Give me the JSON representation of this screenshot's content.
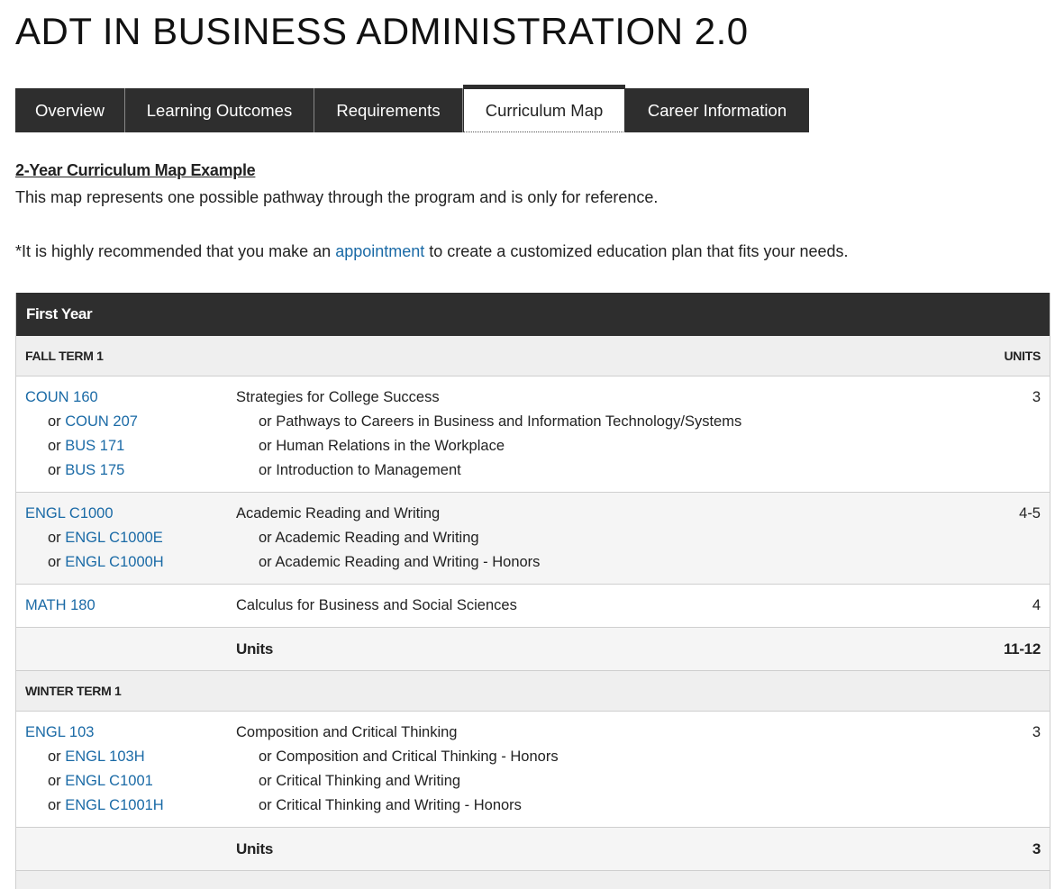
{
  "page": {
    "title": "ADT IN BUSINESS ADMINISTRATION 2.0"
  },
  "tabs": [
    {
      "label": "Overview",
      "active": false
    },
    {
      "label": "Learning Outcomes",
      "active": false
    },
    {
      "label": "Requirements",
      "active": false
    },
    {
      "label": "Curriculum Map",
      "active": true
    },
    {
      "label": "Career Information",
      "active": false
    }
  ],
  "intro": {
    "heading": "2-Year Curriculum Map Example",
    "text": "This map represents one possible pathway through the program and is only for reference.",
    "note_before": "*It is highly recommended that you make an ",
    "note_link": "appointment",
    "note_after": " to create a customized education plan that fits your needs."
  },
  "table": {
    "year_label": "First Year",
    "units_header": "UNITS",
    "units_label": "Units",
    "fall_term": {
      "label": "FALL TERM 1",
      "courses": [
        {
          "code": "COUN 160",
          "title": "Strategies for College Success",
          "units": "3",
          "alternatives": [
            {
              "code": "COUN 207",
              "title": "or Pathways to Careers in Business and Information Technology/Systems"
            },
            {
              "code": "BUS 171",
              "title": "or Human Relations in the Workplace"
            },
            {
              "code": "BUS 175",
              "title": "or Introduction to Management"
            }
          ]
        },
        {
          "code": "ENGL C1000",
          "title": "Academic Reading and Writing",
          "units": "4-5",
          "alternatives": [
            {
              "code": "ENGL C1000E",
              "title": "or Academic Reading and Writing"
            },
            {
              "code": "ENGL C1000H",
              "title": "or Academic Reading and Writing - Honors"
            }
          ]
        },
        {
          "code": "MATH 180",
          "title": "Calculus for Business and Social Sciences",
          "units": "4",
          "alternatives": []
        }
      ],
      "total_units": "11-12"
    },
    "winter_term": {
      "label": "WINTER TERM 1",
      "courses": [
        {
          "code": "ENGL 103",
          "title": "Composition and Critical Thinking",
          "units": "3",
          "alternatives": [
            {
              "code": "ENGL 103H",
              "title": "or Composition and Critical Thinking - Honors"
            },
            {
              "code": "ENGL C1001",
              "title": "or Critical Thinking and Writing"
            },
            {
              "code": "ENGL C1001H",
              "title": "or Critical Thinking and Writing - Honors"
            }
          ]
        }
      ],
      "total_units": "3"
    },
    "or_prefix": "or "
  }
}
